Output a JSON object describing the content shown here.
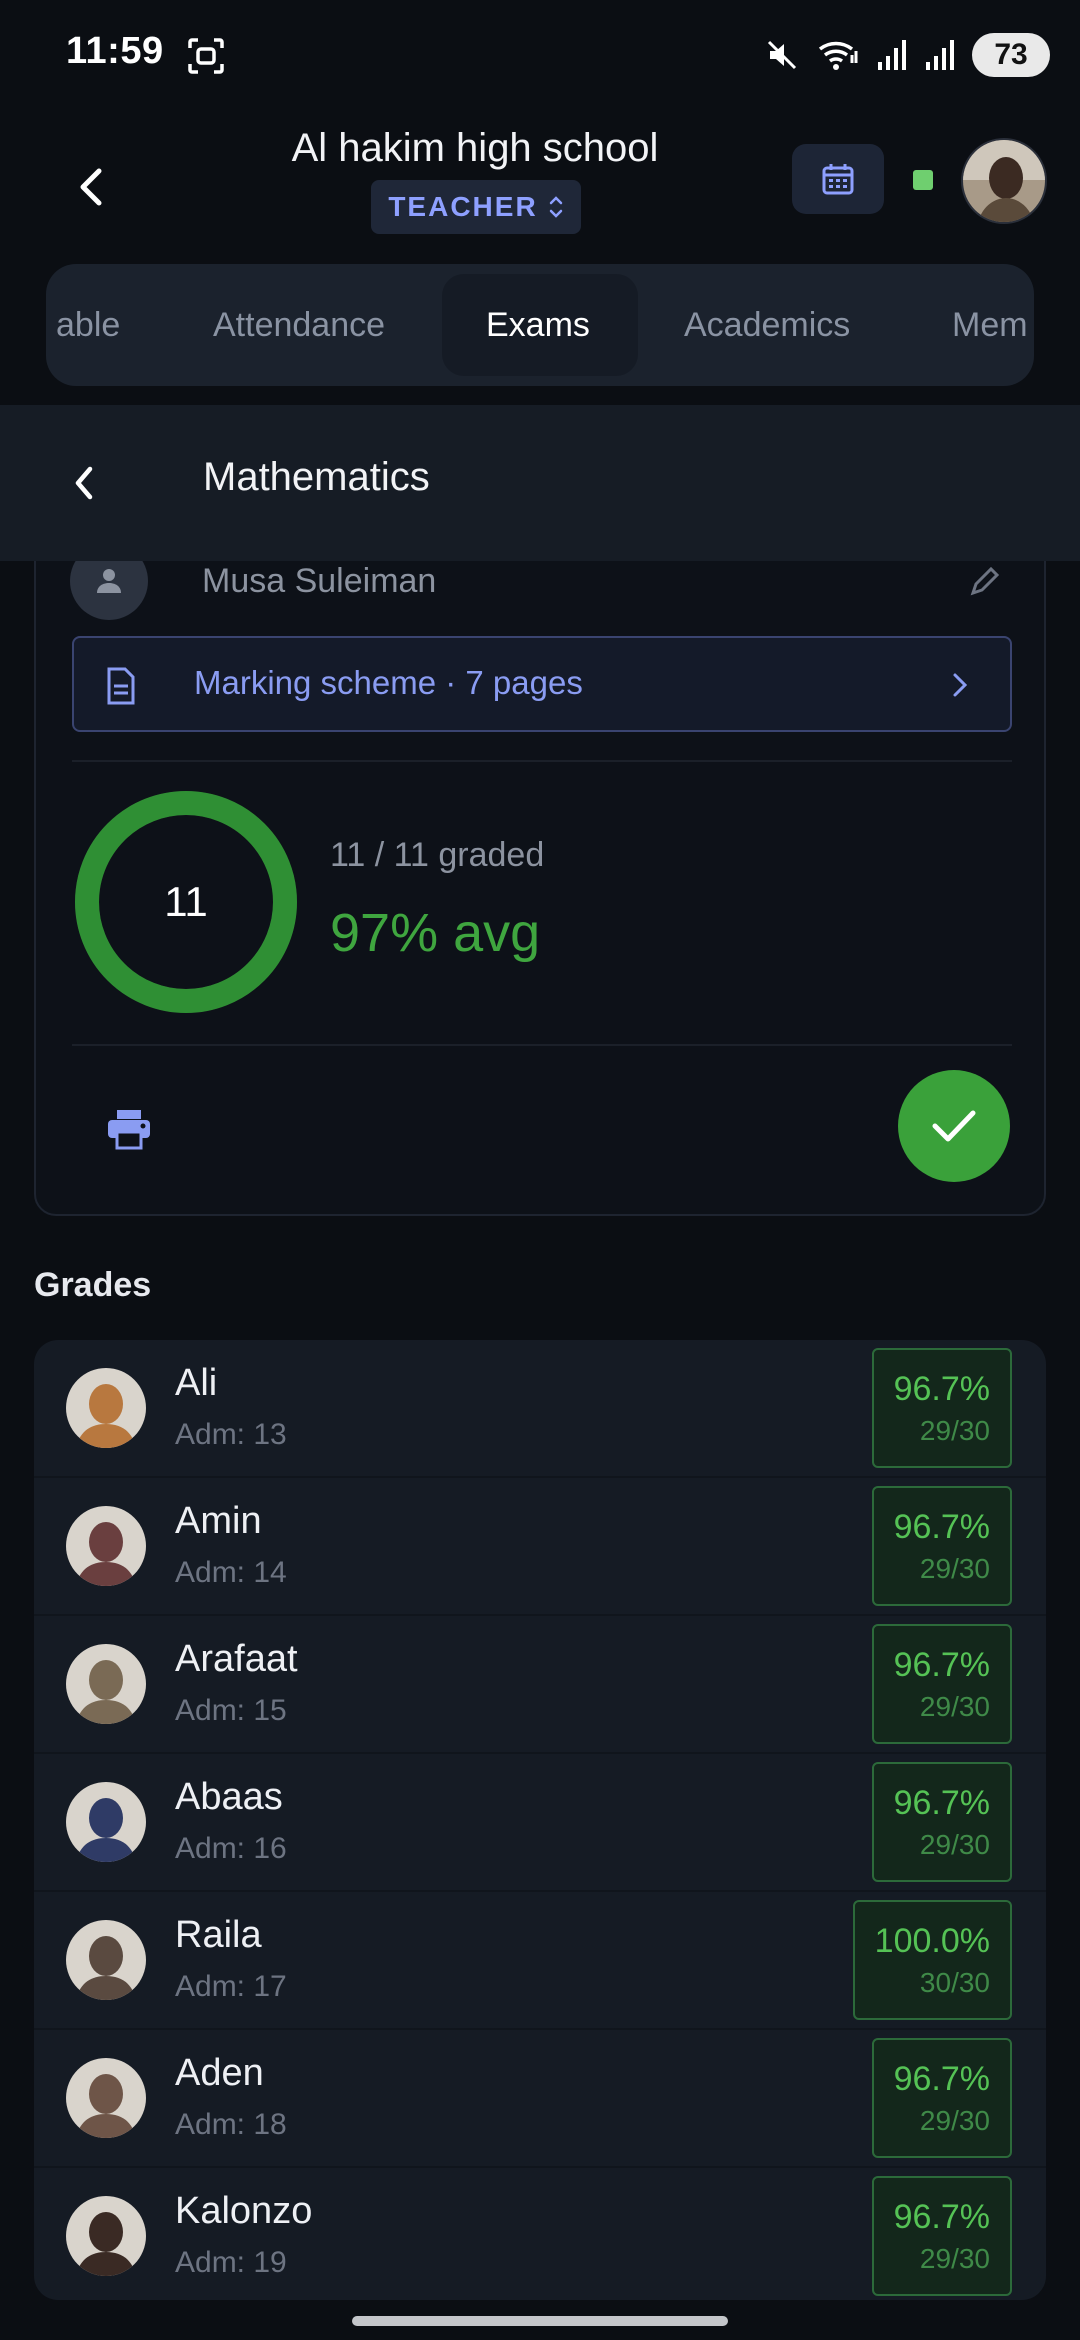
{
  "status_bar": {
    "time": "11:59",
    "battery": "73",
    "icons": [
      "screenshot-icon",
      "mute-icon",
      "wifi-icon",
      "signal-icon",
      "signal-icon",
      "battery-icon"
    ]
  },
  "header": {
    "school_name": "Al hakim high school",
    "role": "TEACHER",
    "status_color": "#6fcf6f"
  },
  "tabs": [
    {
      "label": "able"
    },
    {
      "label": "Attendance"
    },
    {
      "label": "Exams",
      "active": true
    },
    {
      "label": "Academics"
    },
    {
      "label": "Mem"
    }
  ],
  "subheader": {
    "title": "Mathematics"
  },
  "exam": {
    "teacher": "Musa Suleiman",
    "marking_scheme": "Marking scheme · 7 pages",
    "graded_count": "11",
    "graded_progress": 1.0,
    "graded_text": "11 / 11 graded",
    "avg_text": "97% avg"
  },
  "grades": {
    "title": "Grades",
    "rows": [
      {
        "name": "Ali",
        "adm": "Adm: 13",
        "pct": "96.7%",
        "frac": "29/30",
        "avatar_color": "#b8783f"
      },
      {
        "name": "Amin",
        "adm": "Adm: 14",
        "pct": "96.7%",
        "frac": "29/30",
        "avatar_color": "#6a3f3f"
      },
      {
        "name": "Arafaat",
        "adm": "Adm: 15",
        "pct": "96.7%",
        "frac": "29/30",
        "avatar_color": "#7a6a55"
      },
      {
        "name": "Abaas",
        "adm": "Adm: 16",
        "pct": "96.7%",
        "frac": "29/30",
        "avatar_color": "#2f3b66"
      },
      {
        "name": "Raila",
        "adm": "Adm: 17",
        "pct": "100.0%",
        "frac": "30/30",
        "avatar_color": "#5a4a40"
      },
      {
        "name": "Aden",
        "adm": "Adm: 18",
        "pct": "96.7%",
        "frac": "29/30",
        "avatar_color": "#6e5548"
      },
      {
        "name": "Kalonzo",
        "adm": "Adm: 19",
        "pct": "96.7%",
        "frac": "29/30",
        "avatar_color": "#3a2a24"
      }
    ]
  }
}
